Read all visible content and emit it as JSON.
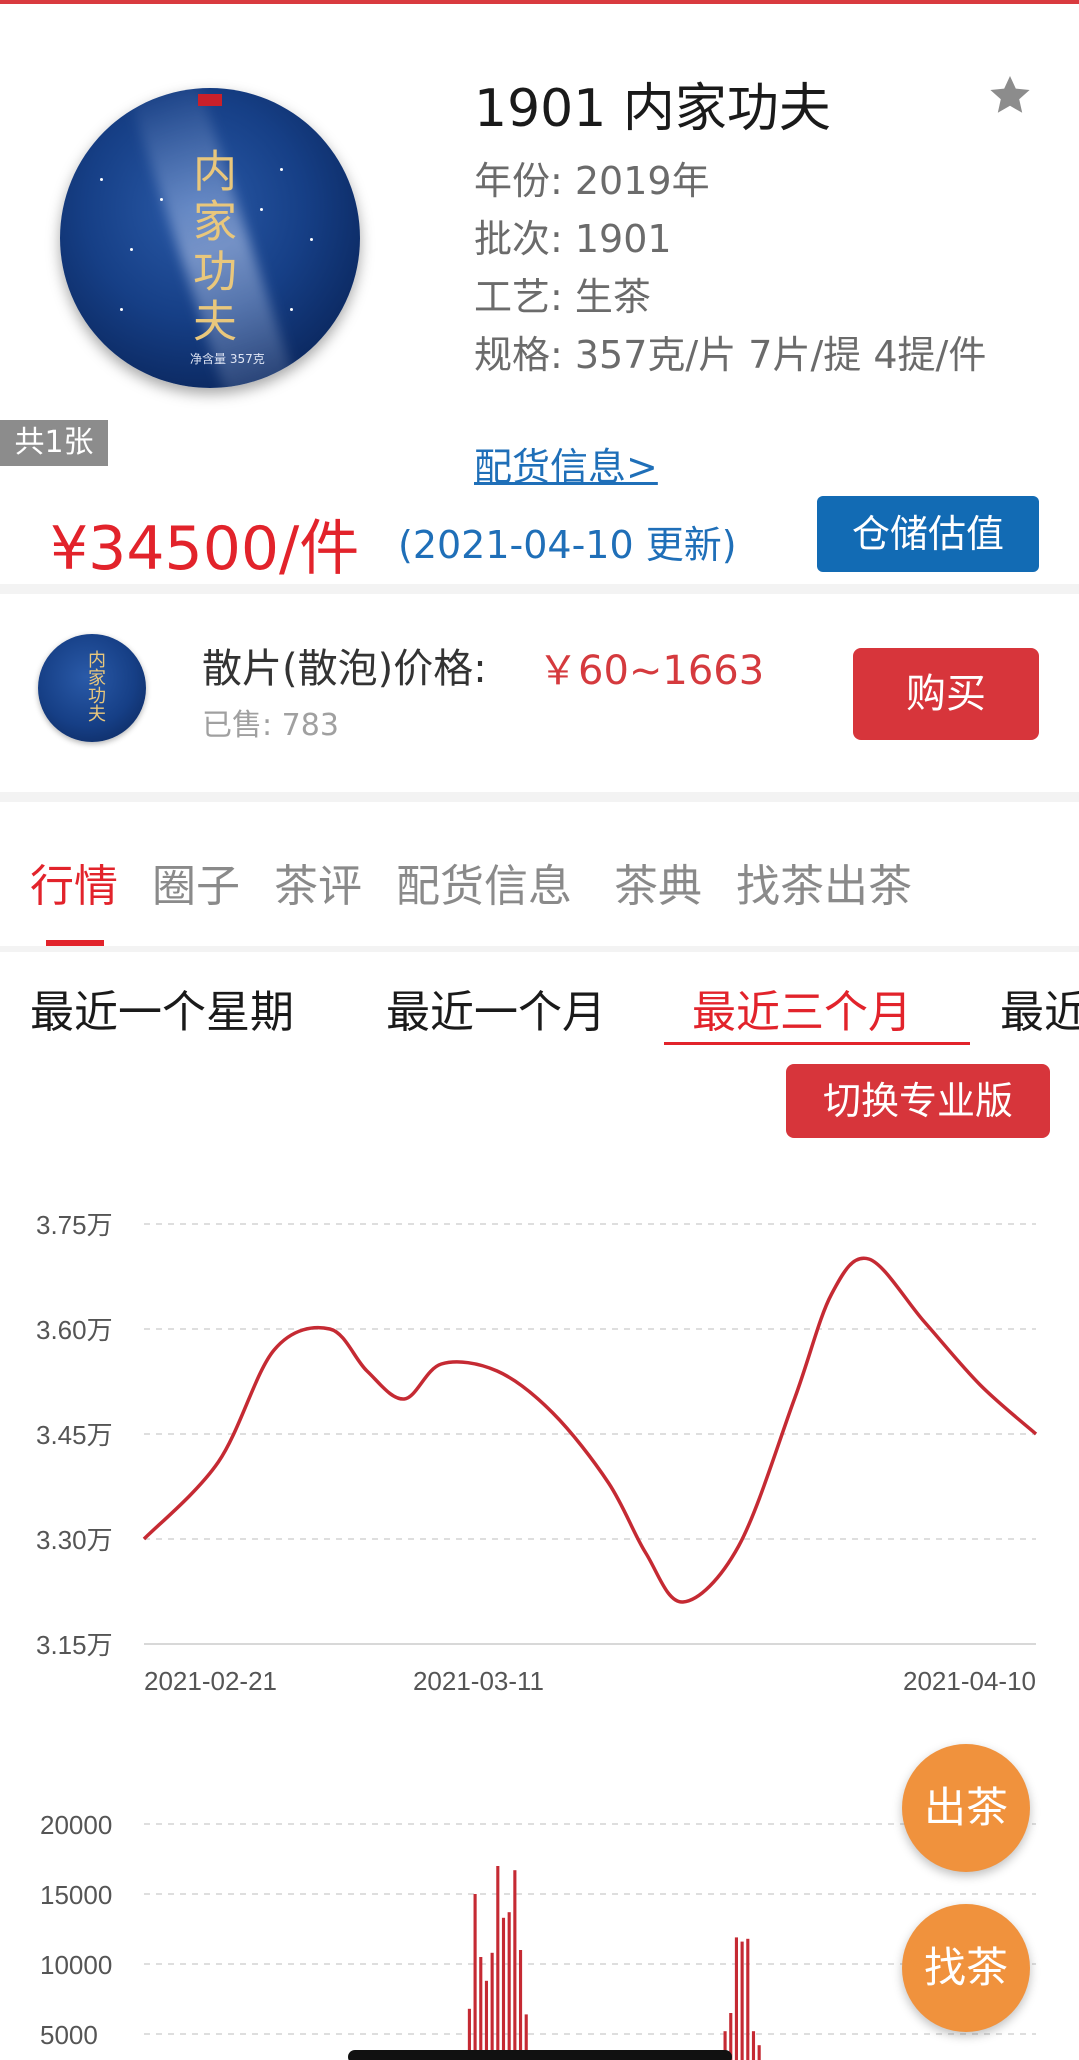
{
  "product": {
    "title": "1901 内家功夫",
    "image_count": "共1张",
    "image_name_text": "内家功夫",
    "image_weight_text": "净含量 357克",
    "specs": [
      "年份: 2019年",
      "批次: 1901",
      "工艺: 生茶",
      "规格: 357克/片 7片/提 4提/件"
    ],
    "distribution_link": "配货信息>",
    "price": "¥34500/件",
    "price_update": "(2021-04-10 更新)",
    "valuation_button": "仓储估值"
  },
  "loose": {
    "label": "散片(散泡)价格:",
    "price": "￥60~1663",
    "sold": "已售: 783",
    "buy_button": "购买"
  },
  "tabs": [
    {
      "label": "行情",
      "active": true
    },
    {
      "label": "圈子"
    },
    {
      "label": "茶评"
    },
    {
      "label": "配货信息"
    },
    {
      "label": "茶典"
    },
    {
      "label": "找茶出茶"
    }
  ],
  "ranges": [
    {
      "label": "最近一个星期"
    },
    {
      "label": "最近一个月"
    },
    {
      "label": "最近三个月",
      "active": true
    },
    {
      "label": "最近"
    }
  ],
  "pro_button": "切换专业版",
  "fab": {
    "sell": "出茶",
    "find": "找茶"
  },
  "colors": {
    "accent_red": "#e2232b",
    "button_red": "#d7353b",
    "link_blue": "#1f6fb8",
    "valuation_blue": "#126bb4",
    "fab_orange": "#f0923d",
    "line_color": "#c52a33"
  },
  "chart_data": [
    {
      "type": "line",
      "title": "",
      "xlabel": "",
      "ylabel": "",
      "y_ticks": [
        "3.15万",
        "3.30万",
        "3.45万",
        "3.60万",
        "3.75万"
      ],
      "x_ticks": [
        "2021-02-21",
        "2021-03-11",
        "2021-04-10"
      ],
      "ylim": [
        31500,
        37500
      ],
      "grid": true,
      "series": [
        {
          "x": [
            "2021-02-21",
            "2021-02-25",
            "2021-02-28",
            "2021-03-03",
            "2021-03-05",
            "2021-03-07",
            "2021-03-09",
            "2021-03-12",
            "2021-03-15",
            "2021-03-18",
            "2021-03-20",
            "2021-03-22",
            "2021-03-25",
            "2021-03-28",
            "2021-03-30",
            "2021-04-01",
            "2021-04-04",
            "2021-04-07",
            "2021-04-10"
          ],
          "y": [
            33000,
            34100,
            35700,
            36000,
            35400,
            35000,
            35500,
            35400,
            34800,
            33800,
            32800,
            32100,
            32900,
            35000,
            36500,
            37000,
            36100,
            35200,
            34500
          ]
        }
      ]
    },
    {
      "type": "bar",
      "title": "",
      "y_ticks": [
        "5000",
        "10000",
        "15000",
        "20000"
      ],
      "ylim": [
        0,
        22000
      ],
      "grid": true,
      "values": [
        0,
        0,
        0,
        0,
        0,
        0,
        0,
        0,
        0,
        0,
        0,
        0,
        0,
        0,
        0,
        0,
        0,
        0,
        0,
        0,
        0,
        0,
        0,
        0,
        0,
        0,
        0,
        0,
        0,
        0,
        0,
        0,
        0,
        0,
        0,
        0,
        0,
        0,
        0,
        0,
        0,
        0,
        0,
        0,
        0,
        0,
        0,
        0,
        0,
        0,
        0,
        0,
        0,
        0,
        0,
        0,
        0,
        6800,
        15000,
        10500,
        8800,
        10800,
        17000,
        13300,
        13700,
        16700,
        11000,
        6400,
        0,
        0,
        0,
        0,
        0,
        0,
        0,
        0,
        0,
        0,
        0,
        0,
        0,
        0,
        0,
        0,
        0,
        0,
        0,
        0,
        0,
        0,
        0,
        0,
        0,
        0,
        0,
        0,
        0,
        0,
        0,
        0,
        0,
        0,
        5200,
        6500,
        11900,
        11600,
        11800,
        5200,
        4200,
        0,
        0,
        0,
        0,
        0,
        0,
        0,
        0,
        0,
        0,
        0,
        0,
        0,
        0,
        0,
        0,
        0,
        0,
        0,
        0,
        0,
        0,
        0,
        0,
        0,
        0,
        0,
        0,
        0,
        0,
        0,
        0,
        0,
        0,
        0,
        0,
        0,
        0,
        0,
        0,
        0,
        0,
        0,
        0,
        0,
        0,
        0,
        0
      ]
    }
  ]
}
